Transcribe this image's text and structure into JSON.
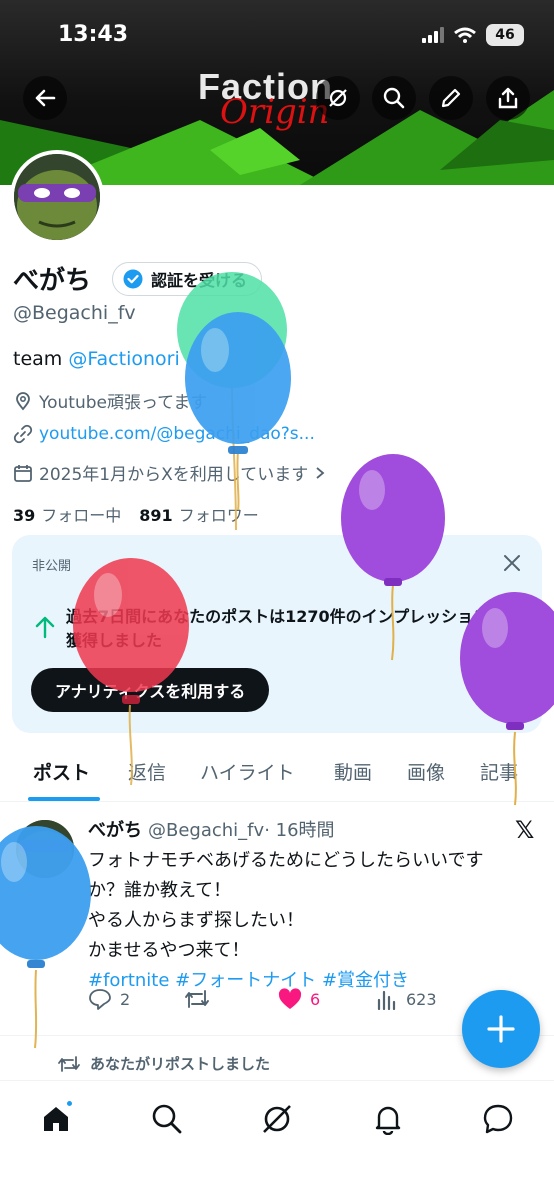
{
  "status_bar": {
    "time": "13:43",
    "battery": "46",
    "signal_icon": "cellular-icon",
    "wifi_icon": "wifi-icon"
  },
  "header": {
    "banner_brand": "Faction",
    "banner_script": "Origin",
    "buttons": [
      "back-icon",
      "grok-icon",
      "search-icon",
      "edit-icon",
      "share-icon"
    ]
  },
  "profile": {
    "name": "べがち",
    "verify_label": "認証を受ける",
    "handle": "@Begachi_fv",
    "bio_prefix": "team ",
    "bio_link": "@Factionori",
    "location": "Youtube頑張ってます",
    "website": "youtube.com/@begachi_dao?s...",
    "joined": "2025年1月からXを利用しています",
    "following_count": "39",
    "following_label": "フォロー中",
    "followers_count": "891",
    "followers_label": "フォロワー"
  },
  "private_card": {
    "label": "非公開",
    "message": "過去7日間にあなたのポストは1270件のインプレッションを獲得しました",
    "button": "アナリティクスを利用する"
  },
  "tabs": [
    "ポスト",
    "返信",
    "ハイライト",
    "動画",
    "画像",
    "記事"
  ],
  "post": {
    "author": "べがち",
    "handle": "@Begachi_fv",
    "time": "· 16時間",
    "lines": [
      "フォトナモチベあげるためにどうしたらいいです",
      "か？誰か教えて！",
      "やる人からまず探したい！",
      "かませるやつ来て！"
    ],
    "tags": "#fortnite #フォートナイト #賞金付き",
    "replies": "2",
    "likes": "6",
    "views": "623"
  },
  "repost_note": "あなたがリポストしました",
  "bottom_nav": [
    "home-icon",
    "search-icon",
    "grok-icon",
    "bell-icon",
    "messages-icon"
  ],
  "colors": {
    "accent": "#1d9bf0",
    "like": "#f91880",
    "text": "#0f1419",
    "secondary": "#536471"
  }
}
